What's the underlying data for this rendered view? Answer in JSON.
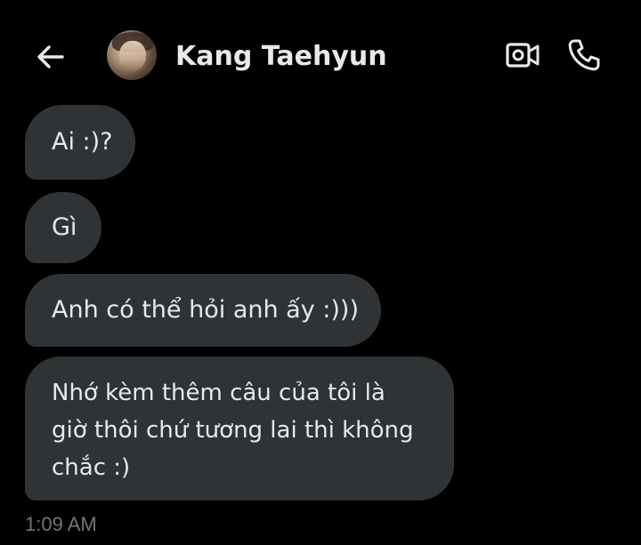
{
  "header": {
    "contact_name": "Kang Taehyun",
    "back_icon": "arrow-left-icon",
    "video_icon": "video-camera-icon",
    "call_icon": "phone-icon"
  },
  "messages": [
    {
      "text": "Ai :)?"
    },
    {
      "text": "Gì"
    },
    {
      "text": "Anh có thể hỏi anh ấy :)))"
    },
    {
      "text": "Nhớ kèm thêm câu của tôi là giờ thôi chứ tương lai thì không chắc :)"
    }
  ],
  "timestamp": "1:09 AM",
  "colors": {
    "background": "#000000",
    "bubble": "#2f3336",
    "text": "#e7e9ea",
    "muted": "#71767b"
  }
}
